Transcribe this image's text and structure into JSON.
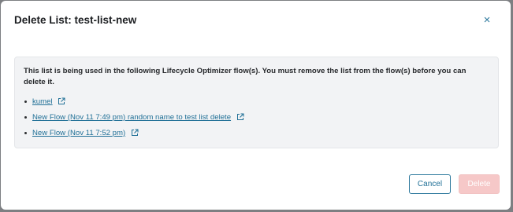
{
  "modal": {
    "title": "Delete List: test-list-new",
    "close_glyph": "×",
    "notice": "This list is being used in the following Lifecycle Optimizer flow(s). You must remove the list from the flow(s) before you can delete it.",
    "flows": [
      {
        "label": "kumel",
        "icon": "external-link-icon"
      },
      {
        "label": "New Flow (Nov 11 7:49 pm) random name to test list delete",
        "icon": "external-link-icon"
      },
      {
        "label": "New Flow (Nov 11 7:52 pm)",
        "icon": "external-link-icon"
      }
    ],
    "cancel_label": "Cancel",
    "delete_label": "Delete"
  },
  "colors": {
    "accent": "#2f7a9e",
    "link": "#1f6f96",
    "delete_disabled": "#f6c8c8",
    "notice_bg": "#f2f3f5"
  }
}
